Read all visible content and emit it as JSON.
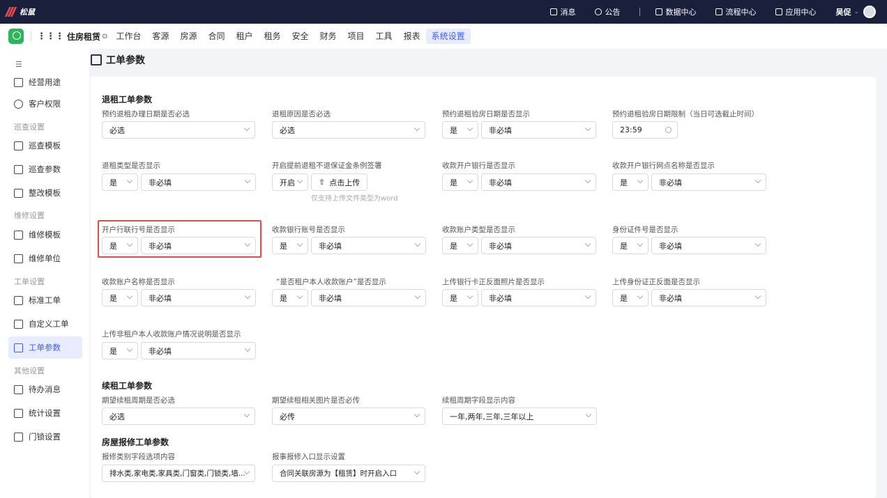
{
  "topbar": {
    "brand": "松鼠",
    "nav": [
      "消息",
      "公告",
      "数据中心",
      "流程中心",
      "应用中心"
    ],
    "user": "吴促",
    "colors": {
      "bg": "#1a1f3c",
      "brand_accent": "#e84a4a"
    }
  },
  "subbar": {
    "app_name": "住房租赁",
    "menu": [
      "工作台",
      "客源",
      "房源",
      "合同",
      "租户",
      "租务",
      "安全",
      "财务",
      "项目",
      "工具",
      "报表",
      "系统设置"
    ],
    "active_menu": "系统设置"
  },
  "sidebar": {
    "items": [
      {
        "label": "经营用途",
        "icon": "building-icon"
      },
      {
        "label": "客户权限",
        "icon": "users-icon"
      },
      {
        "group": "巡查设置"
      },
      {
        "label": "巡查模板",
        "icon": "doc-icon"
      },
      {
        "label": "巡查参数",
        "icon": "doc-icon"
      },
      {
        "label": "整改模板",
        "icon": "fix-icon"
      },
      {
        "group": "维修设置"
      },
      {
        "label": "维修模板",
        "icon": "wrench-icon"
      },
      {
        "label": "维修单位",
        "icon": "wrench-icon"
      },
      {
        "group": "工单设置"
      },
      {
        "label": "标准工单",
        "icon": "form-icon"
      },
      {
        "label": "自定义工单",
        "icon": "form-icon"
      },
      {
        "label": "工单参数",
        "icon": "form-icon",
        "active": true
      },
      {
        "group": "其他设置"
      },
      {
        "label": "待办消息",
        "icon": "message-icon"
      },
      {
        "label": "统计设置",
        "icon": "chart-icon"
      },
      {
        "label": "门锁设置",
        "icon": "lock-icon"
      }
    ]
  },
  "page": {
    "title": "工单参数",
    "accent": "#3e5bf5"
  },
  "sections": {
    "rent_out": {
      "title": "退租工单参数",
      "fields": [
        {
          "label": "预约退租办理日期是否必选",
          "value": "必选"
        },
        {
          "label": "退租原因是否必选",
          "value": "必选"
        },
        {
          "label": "预约退租验房日期是否显示",
          "show": "是",
          "required": "非必填"
        },
        {
          "label": "预约退租验房日期限制（当日可选截止时间）",
          "value": "23:59"
        },
        {
          "label": "退租类型是否显示",
          "show": "是",
          "required": "非必填"
        },
        {
          "label": "开启提前退租不退保证金条例签署",
          "show": "开启",
          "upload": "点击上传",
          "hint": "仅支持上传文件类型为word"
        },
        {
          "label": "收款开户银行是否显示",
          "show": "是",
          "required": "非必填"
        },
        {
          "label": "收款开户银行网点名称是否显示",
          "show": "是",
          "required": "非必填"
        },
        {
          "label": "开户行联行号是否显示",
          "show": "是",
          "required": "非必填"
        },
        {
          "label": "收款银行账号是否显示",
          "show": "是",
          "required": "非必填"
        },
        {
          "label": "收款账户类型是否显示",
          "show": "是",
          "required": "非必填"
        },
        {
          "label": "身份证件号是否显示",
          "show": "是",
          "required": "非必填"
        },
        {
          "label": "收款账户名称是否显示",
          "show": "是",
          "required": "非必填"
        },
        {
          "label": "“是否租户本人收款账户”是否显示",
          "show": "是",
          "required": "非必填"
        },
        {
          "label": "上传银行卡正反面照片是否显示",
          "show": "是",
          "required": "非必填"
        },
        {
          "label": "上传身份证正反面是否显示",
          "show": "是",
          "required": "非必填"
        },
        {
          "label": "上传非租户本人收款账户情况说明是否显示",
          "show": "是",
          "required": "非必填"
        }
      ]
    },
    "renew": {
      "title": "续租工单参数",
      "fields": [
        {
          "label": "期望续租周期是否必选",
          "value": "必选"
        },
        {
          "label": "期望续租相关图片是否必传",
          "value": "必传"
        },
        {
          "label": "续租周期字段显示内容",
          "value": "一年,两年,三年,三年以上"
        }
      ]
    },
    "repair": {
      "title": "房屋报修工单参数",
      "fields": [
        {
          "label": "报修类别字段选项内容",
          "value": "排水类,家电类,家具类,门窗类,门锁类,墙..."
        },
        {
          "label": "报事报修入口显示设置",
          "value": "合同关联房源为【租赁】时开启入口"
        }
      ]
    }
  },
  "highlight_color": "#e24b4b"
}
